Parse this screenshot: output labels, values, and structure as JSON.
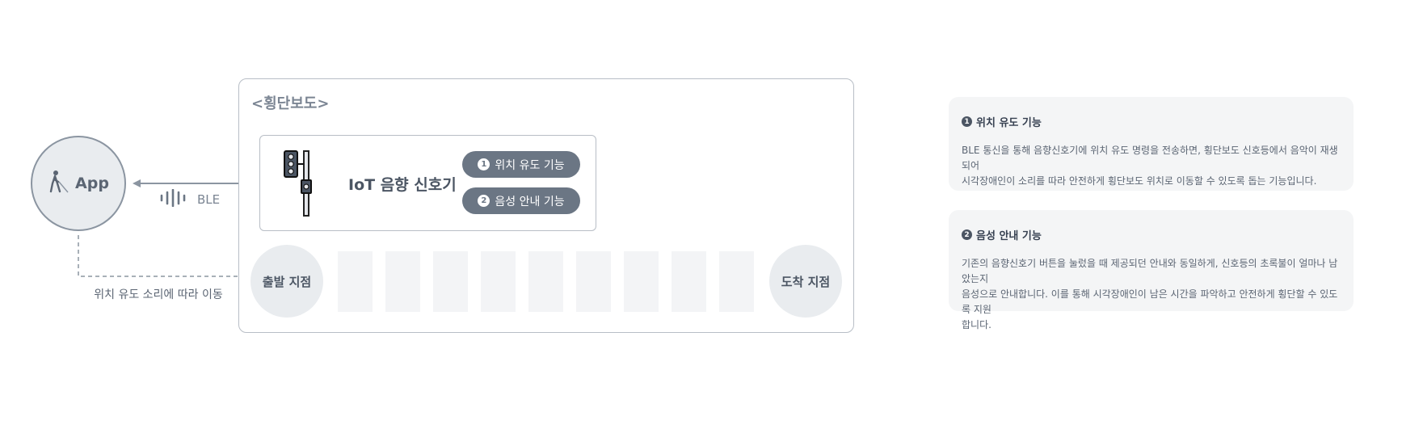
{
  "app": {
    "label": "App",
    "icon": "blind-person-cane-icon"
  },
  "ble": {
    "label": "BLE",
    "icon": "sound-wave-icon"
  },
  "move_label": "위치 유도 소리에 따라 이동",
  "crosswalk": {
    "title": "<횡단보도>"
  },
  "device": {
    "title": "IoT 음향 신호기",
    "icon": "traffic-signal-icon"
  },
  "functions": [
    {
      "num": "1",
      "label": "위치 유도 기능"
    },
    {
      "num": "2",
      "label": "음성 안내 기능"
    }
  ],
  "nodes": {
    "start": "출발 지점",
    "end": "도착 지점"
  },
  "stripe_count": 9,
  "cards": [
    {
      "num": "1",
      "title": "위치 유도 기능",
      "lines": [
        "BLE 통신을 통해 음향신호기에 위치 유도 명령을 전송하면, 횡단보도 신호등에서 음악이 재생되어",
        "시각장애인이 소리를 따라 안전하게 횡단보도 위치로 이동할 수 있도록 돕는 기능입니다."
      ]
    },
    {
      "num": "2",
      "title": "음성 안내 기능",
      "lines": [
        "기존의 음향신호기 버튼을 눌렀을 때 제공되던 안내와 동일하게, 신호등의 초록불이 얼마나 남았는지",
        "음성으로 안내합니다. 이를 통해 시각장애인이 남은 시간을 파악하고 안전하게 횡단할 수 있도록 지원",
        "합니다."
      ]
    }
  ],
  "colors": {
    "accent": "#6b7684",
    "line": "#8b95a1",
    "card_bg": "#f4f5f6",
    "node_bg": "#e9ecef"
  }
}
